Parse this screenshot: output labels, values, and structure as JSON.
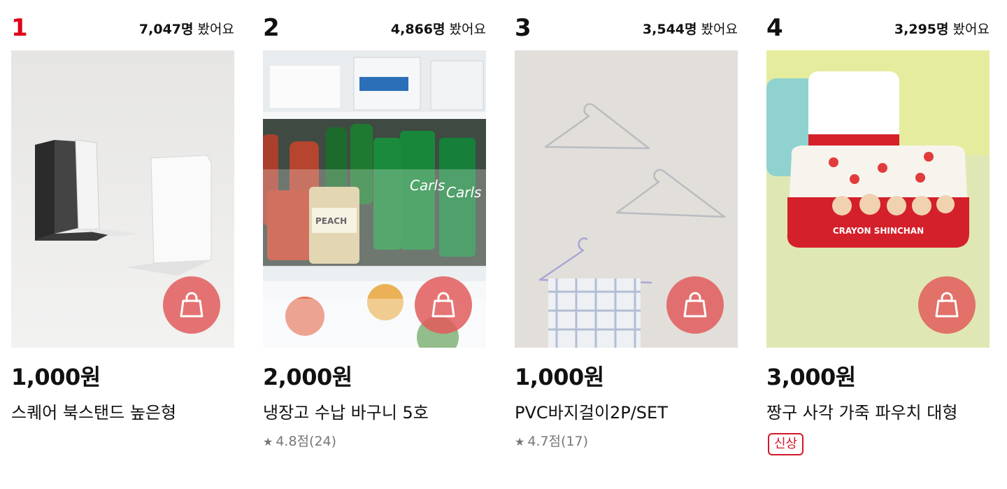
{
  "products": [
    {
      "rank": "1",
      "views_count": "7,047명",
      "views_suffix": " 봤어요",
      "price": "1,000원",
      "name": "스퀘어 북스탠드 높은형",
      "image": "white and black bookend stands",
      "cart_icon": "shopping-bag-icon"
    },
    {
      "rank": "2",
      "views_count": "4,866명",
      "views_suffix": " 봤어요",
      "price": "2,000원",
      "name": "냉장고 수납 바구니 5호",
      "rating": "4.8점(24)",
      "image": "refrigerator storage baskets with drinks",
      "cart_icon": "shopping-bag-icon"
    },
    {
      "rank": "3",
      "views_count": "3,544명",
      "views_suffix": " 봤어요",
      "price": "1,000원",
      "name": "PVC바지걸이2P/SET",
      "rating": "4.7점(17)",
      "image": "wire trouser hangers",
      "cart_icon": "shopping-bag-icon"
    },
    {
      "rank": "4",
      "views_count": "3,295명",
      "views_suffix": " 봤어요",
      "price": "3,000원",
      "name": "짱구 사각 가죽 파우치 대형",
      "badge": "신상",
      "image": "crayon shinchan leather pouch",
      "image_label": "CRAYON SHINCHAN",
      "cart_icon": "shopping-bag-icon"
    }
  ],
  "colors": {
    "rank_top": "#e0001b",
    "cart_button": "#e25c5c",
    "badge": "#d3182a"
  }
}
